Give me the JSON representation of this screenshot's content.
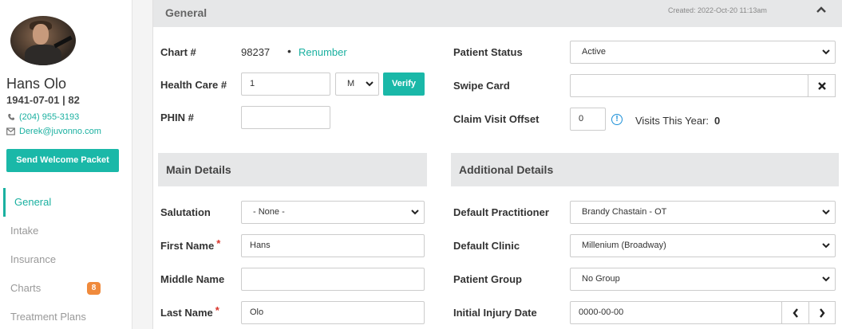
{
  "patient": {
    "name": "Hans Olo",
    "dob_age": "1941-07-01 | 82",
    "phone": "(204) 955-3193",
    "email": "Derek@juvonno.com",
    "welcome_button": "Send Welcome Packet"
  },
  "nav": [
    {
      "label": "General",
      "active": true
    },
    {
      "label": "Intake"
    },
    {
      "label": "Insurance"
    },
    {
      "label": "Charts",
      "badge": "8"
    },
    {
      "label": "Treatment Plans"
    }
  ],
  "panel": {
    "title": "General",
    "created": "Created: 2022-Oct-20 11:13am"
  },
  "general": {
    "chart_label": "Chart #",
    "chart_value": "98237",
    "renumber": "Renumber",
    "health_label": "Health Care #",
    "health_value": "1",
    "health_province": "M",
    "verify": "Verify",
    "phin_label": "PHIN #",
    "phin_value": "",
    "status_label": "Patient Status",
    "status_value": "Active",
    "swipe_label": "Swipe Card",
    "swipe_value": "",
    "offset_label": "Claim Visit Offset",
    "offset_value": "0",
    "visits_label": "Visits This Year:",
    "visits_value": "0"
  },
  "main_details": {
    "title": "Main Details",
    "salutation_label": "Salutation",
    "salutation_value": "- None -",
    "first_label": "First Name",
    "first_value": "Hans",
    "middle_label": "Middle Name",
    "middle_value": "",
    "last_label": "Last Name",
    "last_value": "Olo",
    "required_mark": "*"
  },
  "additional_details": {
    "title": "Additional Details",
    "practitioner_label": "Default Practitioner",
    "practitioner_value": "Brandy Chastain - OT",
    "clinic_label": "Default Clinic",
    "clinic_value": "Millenium (Broadway)",
    "group_label": "Patient Group",
    "group_value": "No Group",
    "injury_label": "Initial Injury Date",
    "injury_value": "0000-00-00"
  },
  "colors": {
    "accent": "#1ab8a8",
    "badge": "#f08a3c",
    "required": "#d9342b",
    "info": "#1a8fd8"
  }
}
